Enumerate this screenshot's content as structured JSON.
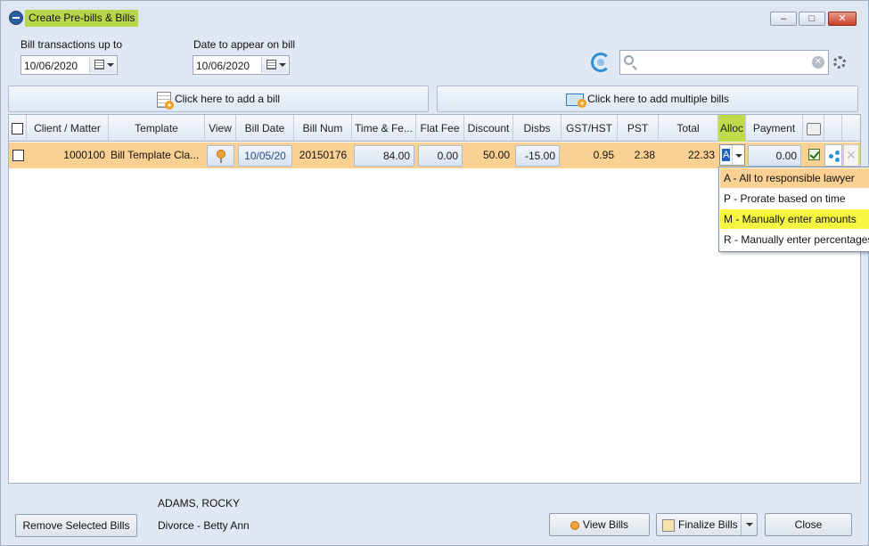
{
  "window": {
    "title": "Create Pre-bills & Bills",
    "controls": {
      "minimize": "–",
      "maximize": "□",
      "close": "✕"
    }
  },
  "filters": {
    "bill_up_to_label": "Bill transactions up to",
    "bill_up_to_value": "10/06/2020",
    "date_on_bill_label": "Date to appear on bill",
    "date_on_bill_value": "10/06/2020"
  },
  "search": {
    "placeholder": "",
    "value": ""
  },
  "toolbar": {
    "add_bill_label": "Click here to add a bill",
    "add_multiple_label": "Click here to add multiple bills"
  },
  "table": {
    "columns": {
      "client_matter": "Client / Matter",
      "template": "Template",
      "view": "View",
      "bill_date": "Bill Date",
      "bill_num": "Bill Num",
      "time_fees": "Time & Fe...",
      "flat_fee": "Flat Fee",
      "discount": "Discount",
      "disbs": "Disbs",
      "gst_hst": "GST/HST",
      "pst": "PST",
      "total": "Total",
      "alloc": "Alloc",
      "payment": "Payment"
    },
    "rows": [
      {
        "client_matter": "1000100",
        "template": "Bill Template Cla...",
        "bill_date": "10/05/20",
        "bill_num": "20150176",
        "time_fees": "84.00",
        "flat_fee": "0.00",
        "discount": "50.00",
        "disbs": "-15.00",
        "gst_hst": "0.95",
        "pst": "2.38",
        "total": "22.33",
        "alloc": "A",
        "payment": "0.00"
      }
    ]
  },
  "alloc_dropdown": {
    "options": [
      "A - All to responsible lawyer",
      "P - Prorate based on time",
      "M - Manually enter amounts",
      "R - Manually enter percentages"
    ]
  },
  "footer": {
    "client_name": "ADAMS, ROCKY",
    "matter_name": "Divorce - Betty Ann",
    "remove_label": "Remove Selected Bills",
    "view_bills_label": "View Bills",
    "finalize_label": "Finalize Bills",
    "close_label": "Close"
  },
  "colors": {
    "row_highlight": "#fbd193",
    "alloc_header": "#c0dc4a",
    "title_highlight": "#b8d64a",
    "option_highlight": "#f5f542"
  }
}
